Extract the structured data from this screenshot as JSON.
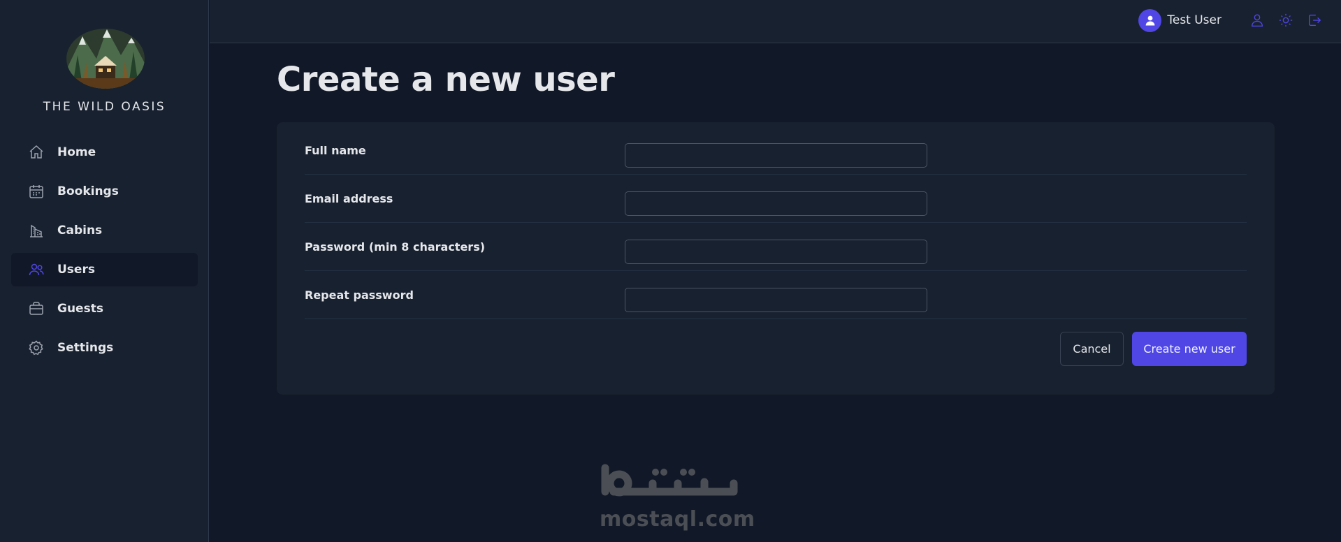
{
  "app": {
    "brand": "THE WILD OASIS",
    "accent_color": "#4f46e5"
  },
  "sidebar": {
    "items": [
      {
        "label": "Home",
        "icon": "home-icon",
        "active": false
      },
      {
        "label": "Bookings",
        "icon": "calendar-icon",
        "active": false
      },
      {
        "label": "Cabins",
        "icon": "building-icon",
        "active": false
      },
      {
        "label": "Users",
        "icon": "users-icon",
        "active": true
      },
      {
        "label": "Guests",
        "icon": "briefcase-icon",
        "active": false
      },
      {
        "label": "Settings",
        "icon": "gear-icon",
        "active": false
      }
    ]
  },
  "header": {
    "user_name": "Test User",
    "icons": [
      "user-icon",
      "sun-icon",
      "logout-icon"
    ]
  },
  "main": {
    "title": "Create a new user",
    "form": {
      "fields": [
        {
          "label": "Full name",
          "value": "",
          "placeholder": ""
        },
        {
          "label": "Email address",
          "value": "",
          "placeholder": ""
        },
        {
          "label": "Password (min 8 characters)",
          "value": "",
          "placeholder": ""
        },
        {
          "label": "Repeat password",
          "value": "",
          "placeholder": ""
        }
      ],
      "cancel_label": "Cancel",
      "submit_label": "Create new user"
    }
  },
  "watermark": {
    "arabic": "مستقل",
    "latin": "mostaql.com"
  }
}
